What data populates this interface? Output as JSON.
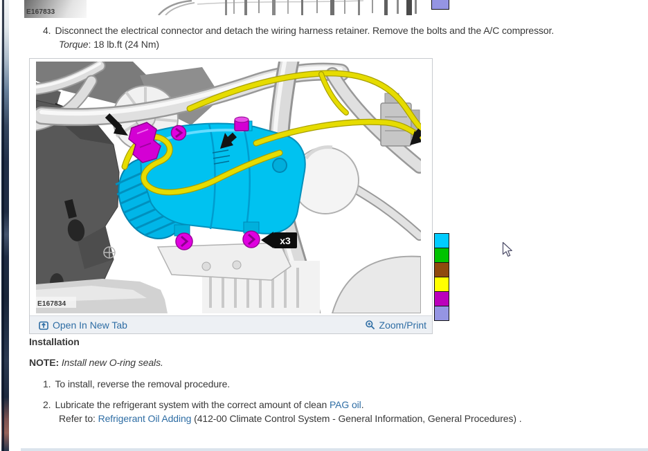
{
  "prev_figure": {
    "label": "E167833"
  },
  "step4": {
    "number": "4.",
    "text": "Disconnect the electrical connector and detach the wiring harness retainer. Remove the bolts and the A/C compressor.",
    "torque_label": "Torque",
    "torque_value": ": 18 lb.ft (24 Nm)"
  },
  "figure": {
    "label": "E167834",
    "open_link": "Open In New Tab",
    "zoom_link": "Zoom/Print",
    "badge": "x3"
  },
  "legend": {
    "top_partial_hex": "#9595E3",
    "colors": [
      {
        "name": "cyan",
        "hex": "#00CCFF"
      },
      {
        "name": "green",
        "hex": "#00C300"
      },
      {
        "name": "brown",
        "hex": "#8F4A0E"
      },
      {
        "name": "yellow",
        "hex": "#FFFF00"
      },
      {
        "name": "magenta",
        "hex": "#BB00BB"
      },
      {
        "name": "lavender",
        "hex": "#9595E3"
      }
    ]
  },
  "installation": {
    "heading": "Installation",
    "note_label": "NOTE:",
    "note_text": "Install new O-ring seals.",
    "step1_number": "1.",
    "step1_text": "To install, reverse the removal procedure.",
    "step2_number": "2.",
    "step2_text": "Lubricate the refrigerant system with the correct amount of clean ",
    "step2_link": "PAG oil",
    "step2_period": ".",
    "refer_prefix": "Refer to: ",
    "refer_link": "Refrigerant Oil Adding",
    "refer_suffix": " (412-00 Climate Control System - General Information, General Procedures) ."
  },
  "link_color": "#2E6DA4"
}
